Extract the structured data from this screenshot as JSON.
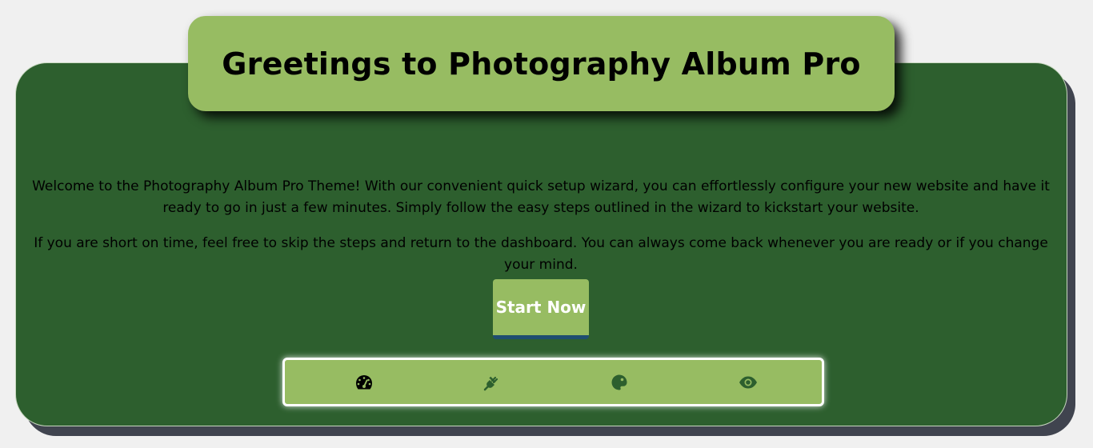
{
  "header": {
    "title": "Greetings to Photography Album Pro"
  },
  "main": {
    "paragraphs": [
      "Welcome to the Photography Album Pro Theme! With our convenient quick setup wizard, you can effortlessly configure your new website and have it ready to go in just a few minutes. Simply follow the easy steps outlined in the wizard to kickstart your website.",
      "If you are short on time, feel free to skip the steps and return to the dashboard. You can always come back whenever you are ready or if you change your mind."
    ],
    "start_button": "Start Now"
  },
  "steps": [
    {
      "icon": "dashboard-gauge-icon",
      "color": "#000000"
    },
    {
      "icon": "plugin-plug-icon",
      "color": "#2d5f2e"
    },
    {
      "icon": "palette-icon",
      "color": "#2d5f2e"
    },
    {
      "icon": "eye-icon",
      "color": "#2d5f2e"
    }
  ],
  "colors": {
    "background": "#f0f0f0",
    "card": "#2d5f2e",
    "card_shadow": "#40444f",
    "accent": "#97bc62",
    "button_underline": "#1f4e70"
  }
}
